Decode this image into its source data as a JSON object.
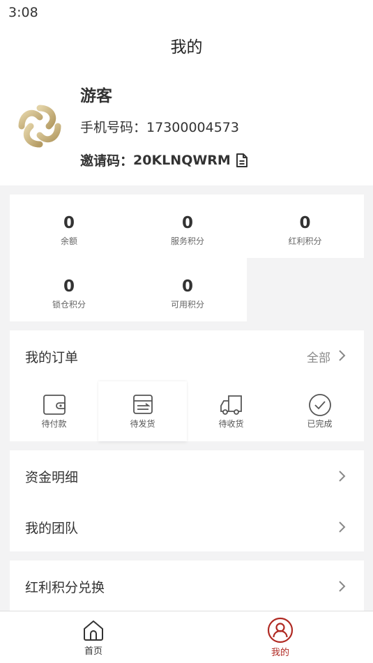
{
  "status_bar": {
    "time": "3:08"
  },
  "header": {
    "title": "我的"
  },
  "profile": {
    "name": "游客",
    "phone_label": "手机号码：",
    "phone_value": "17300004573",
    "invite_label": "邀请码：",
    "invite_value": "20KLNQWRM"
  },
  "stats": [
    {
      "value": "0",
      "label": "余额"
    },
    {
      "value": "0",
      "label": "服务积分"
    },
    {
      "value": "0",
      "label": "红利积分"
    },
    {
      "value": "0",
      "label": "锁仓积分"
    },
    {
      "value": "0",
      "label": "可用积分"
    }
  ],
  "orders": {
    "title": "我的订单",
    "all_label": "全部",
    "items": [
      {
        "label": "待付款",
        "icon": "wallet-icon"
      },
      {
        "label": "待发货",
        "icon": "package-icon"
      },
      {
        "label": "待收货",
        "icon": "truck-icon"
      },
      {
        "label": "已完成",
        "icon": "check-circle-icon"
      }
    ]
  },
  "menu": [
    {
      "label": "资金明细"
    },
    {
      "label": "我的团队"
    },
    {
      "label": "红利积分兑换"
    }
  ],
  "tabbar": {
    "tabs": [
      {
        "label": "首页",
        "icon": "home-icon",
        "active": false
      },
      {
        "label": "我的",
        "icon": "user-icon",
        "active": true
      }
    ],
    "active_color": "#b02a23"
  },
  "colors": {
    "accent": "#b02a23",
    "logo_gold": "#c8b07a"
  }
}
